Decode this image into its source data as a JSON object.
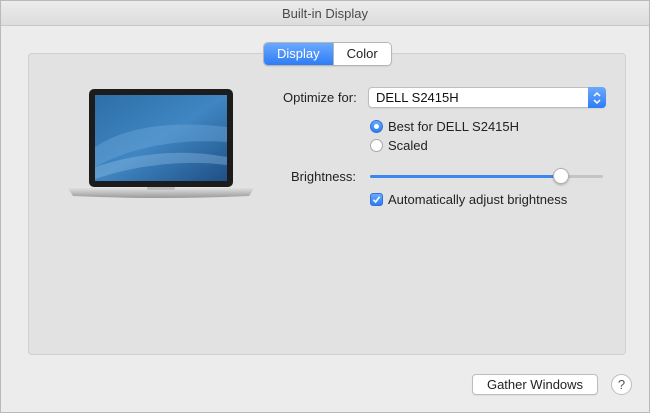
{
  "window": {
    "title": "Built-in Display"
  },
  "tabs": [
    {
      "label": "Display",
      "active": true
    },
    {
      "label": "Color",
      "active": false
    }
  ],
  "optimize": {
    "label": "Optimize for:",
    "value": "DELL S2415H"
  },
  "resolution": {
    "options": [
      {
        "label": "Best for DELL S2415H",
        "selected": true
      },
      {
        "label": "Scaled",
        "selected": false
      }
    ]
  },
  "brightness": {
    "label": "Brightness:",
    "level": 0.82,
    "auto_label": "Automatically adjust brightness",
    "auto_checked": true
  },
  "footer": {
    "gather_label": "Gather Windows",
    "help_label": "?"
  },
  "colors": {
    "accent": "#2d7df5"
  }
}
